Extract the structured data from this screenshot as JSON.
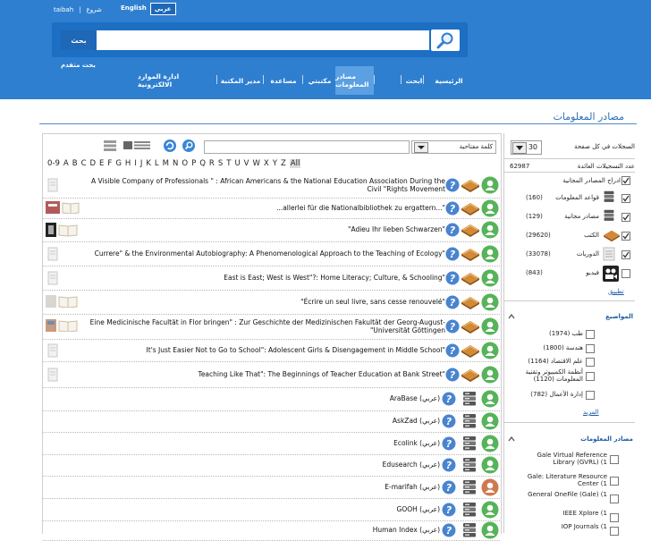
{
  "header": {
    "taibah": "taibah",
    "extra": "شروع",
    "lang_en": "English",
    "lang_ar": "عربي",
    "search_button": "بحث",
    "advanced_search": "بحث متقدم"
  },
  "nav": [
    {
      "label": "الرئيسية"
    },
    {
      "label": "ابحث"
    },
    {
      "label": "مصادر المعلومات",
      "active": true
    },
    {
      "label": "مكتبتي"
    },
    {
      "label": "مساعدة"
    },
    {
      "label": "مدير المكتبة"
    },
    {
      "label": "ادارة الموارد الالكترونية"
    }
  ],
  "page_title": "مصادر المعلومات",
  "controls": {
    "keyword_select": "كلمة مفتاحية",
    "per_page_label": "السجلات في كل صفحة",
    "per_page": "30"
  },
  "alphabet": [
    "0-9",
    "A",
    "B",
    "C",
    "D",
    "E",
    "F",
    "G",
    "H",
    "I",
    "J",
    "K",
    "L",
    "M",
    "N",
    "O",
    "P",
    "Q",
    "R",
    "S",
    "T",
    "U",
    "V",
    "W",
    "X",
    "Y",
    "Z",
    "All"
  ],
  "rows": [
    {
      "title": "A Visible Company of Professionals \" : African Americans & the National Education Association During the Civil \"Rights Movement",
      "thumb": "doc",
      "type": "book"
    },
    {
      "title": "...allerlei für die Nationalbibliothek zu ergattern...\"",
      "thumb": "book",
      "type": "book"
    },
    {
      "title": "\"Adieu Ihr lieben Schwarzen\"",
      "thumb": "photo",
      "type": "book"
    },
    {
      "title": "Currere\" & the Environmental Autobiography: A Phenomenological Approach to the Teaching of Ecology\"",
      "thumb": "doc",
      "type": "book"
    },
    {
      "title": "East is East; West is West\"?: Home Literacy; Culture, & Schooling\"",
      "thumb": "doc",
      "type": "book"
    },
    {
      "title": "\"Écrire un seul livre, sans cesse renouvelé\"",
      "thumb": "book2",
      "type": "book"
    },
    {
      "title": "Eine Medicinische Facultät in Flor bringen\" : Zur Geschichte der Medizinischen Fakultät der Georg-August-\"Universität Göttingen",
      "thumb": "book3",
      "type": "book"
    },
    {
      "title": "It's Just Easier Not to Go to School\": Adolescent Girls & Disengagement in Middle School\"",
      "thumb": "doc",
      "type": "book"
    },
    {
      "title": "Teaching Like That\": The Beginnings of Teacher Education at Bank Street\"",
      "thumb": "doc",
      "type": "book"
    },
    {
      "title": "AraBase (عربي)",
      "thumb": "none",
      "type": "db"
    },
    {
      "title": "AskZad (عربي)",
      "thumb": "none",
      "type": "db"
    },
    {
      "title": "Ecolink (عربي)",
      "thumb": "none",
      "type": "db"
    },
    {
      "title": "Edusearch (عربي)",
      "thumb": "none",
      "type": "db"
    },
    {
      "title": "E-marifah (عربي)",
      "thumb": "none",
      "type": "db",
      "user_color": "#d0784e"
    },
    {
      "title": "GOOH (عربي)",
      "thumb": "none",
      "type": "db"
    },
    {
      "title": "Human Index (عربي)",
      "thumb": "none",
      "type": "db"
    }
  ],
  "sidebar": {
    "total_label": "عدد التسجيلات العائدة",
    "total": "62987",
    "free_label": "ادراج المصادر المجانية",
    "types": [
      {
        "label": "قواعد المعلومات",
        "count": "(160)"
      },
      {
        "label": "مصادر مجانية",
        "count": "(129)"
      },
      {
        "label": "الكتب",
        "count": "(29620)"
      },
      {
        "label": "الدوريات",
        "count": "(33078)"
      },
      {
        "label": "فيديو",
        "count": "(843)"
      }
    ],
    "apply": "تطبيق",
    "subjects_title": "المواضيع",
    "subjects": [
      {
        "label": "طب (1974)"
      },
      {
        "label": "هندسة (1800)"
      },
      {
        "label": "علم الاقتصاد (1164)"
      },
      {
        "label": "أنظمة الكمبيوتر وتقنية المعلومات (1120)"
      },
      {
        "label": "إدارة الأعمال (782)"
      }
    ],
    "more": "المزيد",
    "sources_title": "مصادر المعلومات",
    "sources": [
      {
        "label": "Gale Virtual Reference Library (GVRL) (1"
      },
      {
        "label": "Gale: Literature Resource Center (1"
      },
      {
        "label": "General OneFile (Gale) (1"
      },
      {
        "label": "IEEE Xplore (1"
      },
      {
        "label": "IOP Journals (1"
      }
    ]
  }
}
